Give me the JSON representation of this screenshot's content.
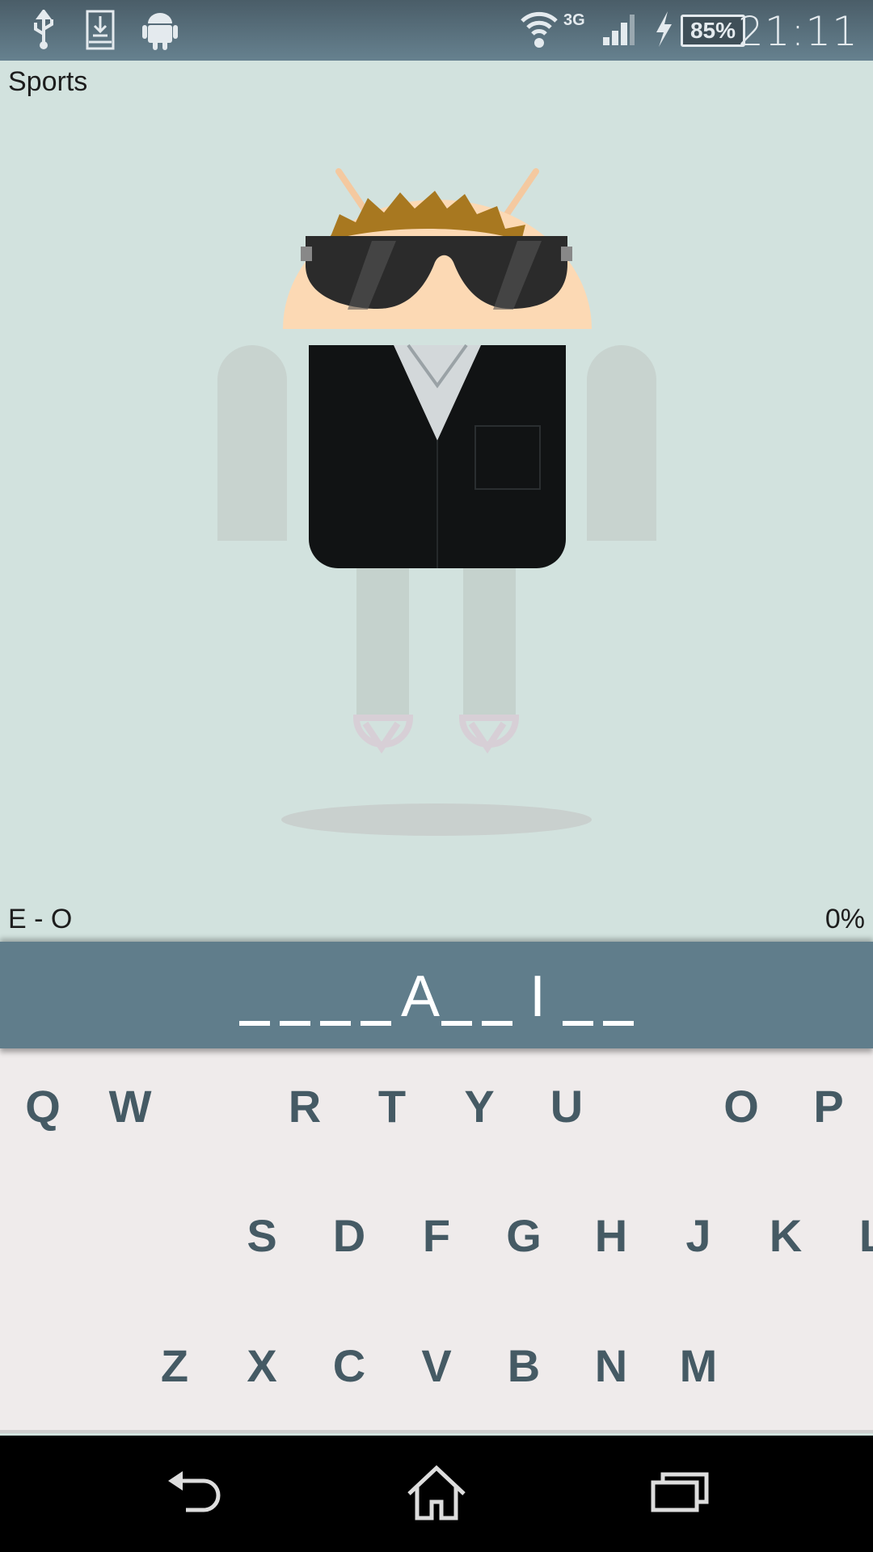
{
  "status_bar": {
    "icons": [
      "usb-icon",
      "download-icon",
      "android-icon",
      "wifi-icon",
      "signal-icon",
      "charging-icon",
      "battery-icon"
    ],
    "network": "3G",
    "battery": "85%",
    "time": "21:11"
  },
  "category": "Sports",
  "score": "E - O",
  "progress": "0%",
  "word": {
    "slots": [
      "",
      "",
      "",
      "",
      "A",
      "",
      "",
      "I",
      "",
      ""
    ]
  },
  "keyboard": {
    "rows": [
      [
        "Q",
        "W",
        "",
        "R",
        "T",
        "Y",
        "U",
        "",
        "O",
        "P"
      ],
      [
        "",
        "S",
        "D",
        "F",
        "G",
        "H",
        "J",
        "K",
        "L"
      ],
      [
        "Z",
        "X",
        "C",
        "V",
        "B",
        "N",
        "M"
      ]
    ]
  },
  "colors": {
    "background": "#d2e2de",
    "word_bar": "#607d8b",
    "key_text": "#455a64",
    "keyboard": "#efebeb"
  },
  "nav": {
    "icons": [
      "back-icon",
      "home-icon",
      "recent-apps-icon"
    ]
  }
}
